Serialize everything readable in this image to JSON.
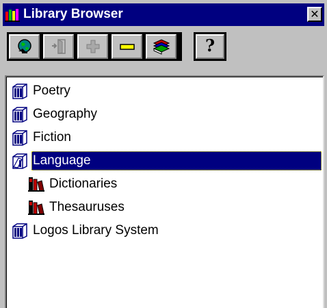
{
  "window": {
    "title": "Library Browser",
    "close_label": "✕"
  },
  "toolbar": {
    "buttons": [
      {
        "name": "connect",
        "icon": "globe-icon"
      },
      {
        "name": "open",
        "icon": "open-door-icon"
      },
      {
        "name": "expand",
        "icon": "plus-icon"
      },
      {
        "name": "collapse",
        "icon": "minus-icon"
      },
      {
        "name": "books",
        "icon": "books-icon"
      }
    ],
    "help_label": "?"
  },
  "tree": {
    "items": [
      {
        "label": "Poetry",
        "icon": "bookshelf-icon",
        "level": 0
      },
      {
        "label": "Geography",
        "icon": "bookshelf-icon",
        "level": 0
      },
      {
        "label": "Fiction",
        "icon": "bookshelf-icon",
        "level": 0
      },
      {
        "label": "Language",
        "icon": "open-bookshelf-icon",
        "level": 0,
        "selected": true
      },
      {
        "label": "Dictionaries",
        "icon": "books-icon",
        "level": 1
      },
      {
        "label": "Thesauruses",
        "icon": "books-icon",
        "level": 1
      },
      {
        "label": "Logos Library System",
        "icon": "bookshelf-icon",
        "level": 0
      }
    ]
  },
  "colors": {
    "titlebar": "#000080",
    "face": "#c0c0c0",
    "selection": "#000080",
    "bookshelf": "#000080",
    "book_red": "#c00000"
  }
}
